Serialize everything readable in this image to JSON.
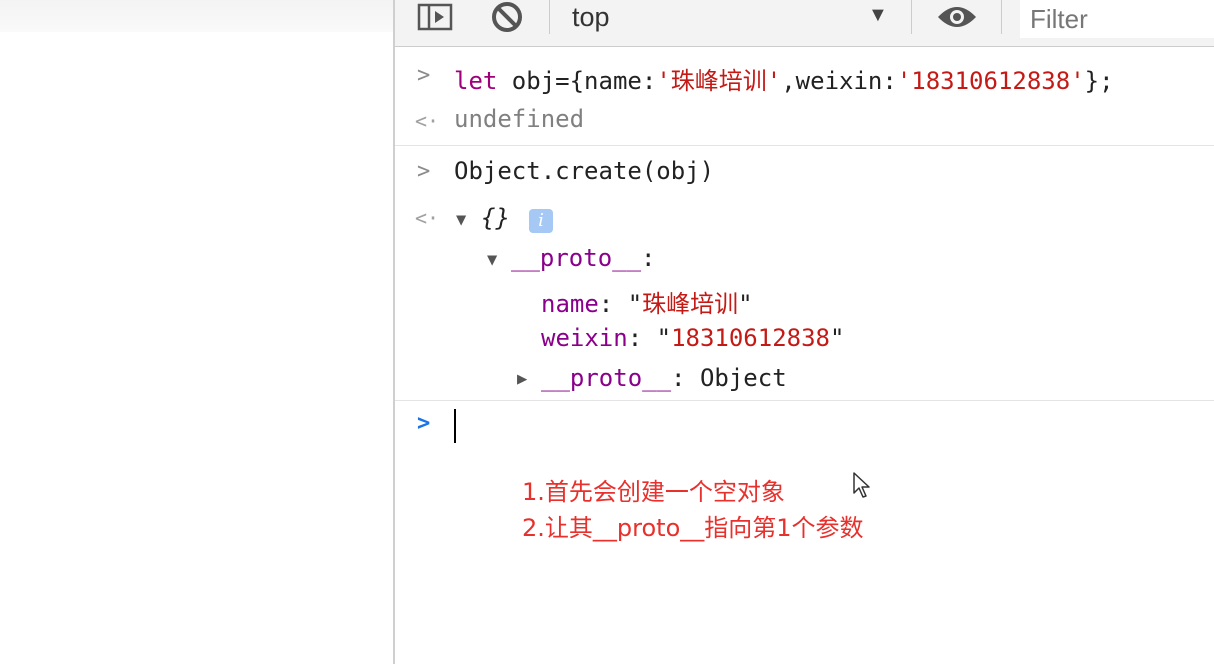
{
  "toolbar": {
    "context_label": "top",
    "context_arrow": "▼",
    "filter_placeholder": "Filter",
    "icons": [
      "sidebar-toggle-icon",
      "clear-console-icon",
      "eye-icon"
    ]
  },
  "console": {
    "entry1": {
      "prompt": ">",
      "kw": "let",
      "p1": " obj={name:",
      "q1": "'",
      "cn_value": "珠峰培训",
      "q2": "'",
      "p2": ",weixin:",
      "s2": "'18310612838'",
      "p3": "};"
    },
    "result1": {
      "marker": "<·",
      "text": "undefined"
    },
    "entry2": {
      "prompt": ">",
      "text": "Object.create(obj)"
    },
    "result2": {
      "marker": "<·",
      "summary": "{}",
      "info": "i",
      "proto_label": "__proto__",
      "colon": ":",
      "props": [
        {
          "key": "name",
          "sep": ": \"",
          "value": "珠峰培训",
          "end": "\""
        },
        {
          "key": "weixin",
          "sep": ": \"",
          "value": "18310612838",
          "end": "\""
        }
      ],
      "nested_proto_label": "__proto__",
      "nested_proto_value": ": Object"
    },
    "input_prompt": ">"
  },
  "annotation": {
    "line1": "1.首先会创建一个空对象",
    "line2": "2.让其__proto__指向第1个参数"
  },
  "colors": {
    "string": "#c41a16",
    "keyword": "#a0007a",
    "property": "#8b008b",
    "annotation": "#e8302c",
    "prompt": "#1a73e8"
  }
}
